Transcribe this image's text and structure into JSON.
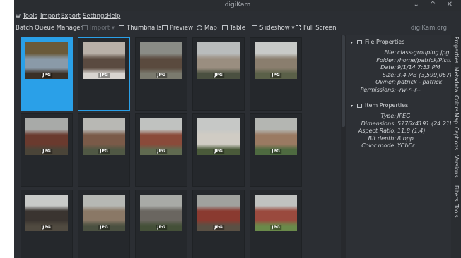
{
  "window": {
    "title": "digiKam",
    "controls": "⌄ ^ ✕"
  },
  "menu": [
    "w",
    "Tools",
    "Import",
    "Export",
    "Settings",
    "Help"
  ],
  "toolbar": {
    "items": [
      {
        "label": "Batch Queue Manager",
        "icon": "",
        "disabled": false
      },
      {
        "label": "Import",
        "icon": "import-icon",
        "disabled": true,
        "arrow": "▾"
      },
      {
        "label": "Thumbnails",
        "icon": "thumbnails-icon",
        "disabled": false
      },
      {
        "label": "Preview",
        "icon": "preview-icon",
        "disabled": false
      },
      {
        "label": "Map",
        "icon": "globe-icon",
        "disabled": false
      },
      {
        "label": "Table",
        "icon": "table-icon",
        "disabled": false
      },
      {
        "label": "Slideshow",
        "icon": "slideshow-icon",
        "disabled": false,
        "arrow": "▾"
      },
      {
        "label": "Full Screen",
        "icon": "fullscreen-icon",
        "disabled": false
      }
    ],
    "brand": "digiKam.org"
  },
  "thumbnails": [
    {
      "badge": "JPG",
      "state": "selected",
      "colors": [
        "#6a5a3a",
        "#8a9aa8",
        "#3a3026"
      ]
    },
    {
      "badge": "JPG",
      "state": "current",
      "colors": [
        "#b8b0a8",
        "#5a4a40",
        "#d8d4d0"
      ]
    },
    {
      "badge": "JPG",
      "state": "",
      "colors": [
        "#8a8c86",
        "#5a4a3e",
        "#7a7a6e"
      ]
    },
    {
      "badge": "JPG",
      "state": "",
      "colors": [
        "#b9bcbc",
        "#9a8e80",
        "#4a5040"
      ]
    },
    {
      "badge": "JPG",
      "state": "",
      "colors": [
        "#c8cac8",
        "#8a7e6e",
        "#5a6048"
      ]
    },
    {
      "badge": "JPG",
      "state": "",
      "colors": [
        "#a8aaa8",
        "#6a3a2e",
        "#4a4438"
      ]
    },
    {
      "badge": "JPG",
      "state": "",
      "colors": [
        "#b8b8b4",
        "#7a5a48",
        "#505844"
      ]
    },
    {
      "badge": "JPG",
      "state": "",
      "colors": [
        "#c0c2c0",
        "#8a4a3a",
        "#606a50"
      ]
    },
    {
      "badge": "JPG",
      "state": "",
      "colors": [
        "#c6c8c6",
        "#d0ccc4",
        "#4a5a3a"
      ]
    },
    {
      "badge": "JPG",
      "state": "",
      "colors": [
        "#b4b6b2",
        "#9a7a62",
        "#4e6a40"
      ]
    },
    {
      "badge": "JPG",
      "state": "",
      "colors": [
        "#c8cac8",
        "#3a3430",
        "#504a40"
      ]
    },
    {
      "badge": "JPG",
      "state": "",
      "colors": [
        "#b6b8b4",
        "#8a7866",
        "#4a5040"
      ]
    },
    {
      "badge": "JPG",
      "state": "",
      "colors": [
        "#a8aaa6",
        "#6a6660",
        "#445038"
      ]
    },
    {
      "badge": "JPG",
      "state": "",
      "colors": [
        "#a0a29e",
        "#8a3a30",
        "#5a5044"
      ]
    },
    {
      "badge": "JPG",
      "state": "",
      "colors": [
        "#c0c2c0",
        "#9a4a3e",
        "#6a8a4a"
      ]
    }
  ],
  "panel": {
    "file_section": {
      "title": "File Properties",
      "icon": "file-icon"
    },
    "file_props": [
      {
        "key": "File:",
        "value": "class-grouping.jpg"
      },
      {
        "key": "Folder:",
        "value": "/home/patrick/Picture..."
      },
      {
        "key": "Date:",
        "value": "9/1/14 7:53 PM"
      },
      {
        "key": "Size:",
        "value": "3.4 MB (3,599,067)"
      },
      {
        "key": "Owner:",
        "value": "patrick - patrick"
      },
      {
        "key": "Permissions:",
        "value": "-rw-r--r--"
      }
    ],
    "item_section": {
      "title": "Item Properties",
      "icon": "item-icon"
    },
    "item_props": [
      {
        "key": "Type:",
        "value": "JPEG"
      },
      {
        "key": "Dimensions:",
        "value": "5776x4191 (24.21Mpx)"
      },
      {
        "key": "Aspect Ratio:",
        "value": "11:8 (1.4)"
      },
      {
        "key": "Bit depth:",
        "value": "8 bpp"
      },
      {
        "key": "Color mode:",
        "value": "YCbCr"
      }
    ]
  },
  "side_tabs": [
    "Properties",
    "Metadata",
    "Colors",
    "Map",
    "Captions",
    "Versions",
    "Filters",
    "Tools"
  ]
}
